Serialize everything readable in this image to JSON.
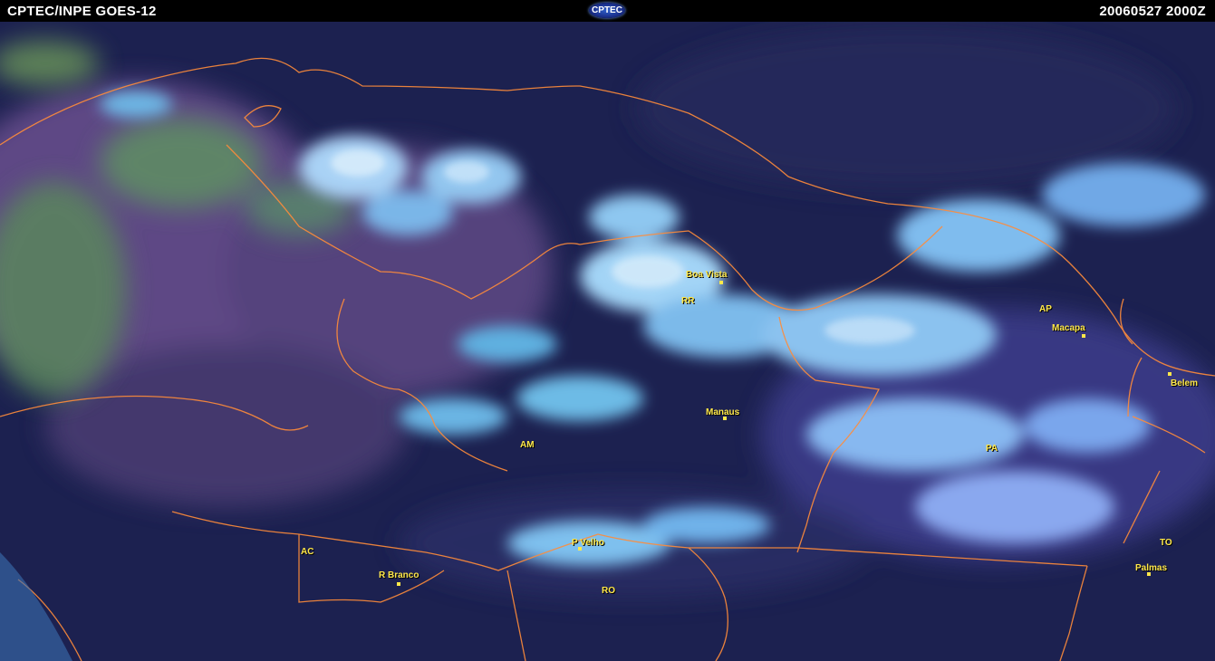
{
  "header": {
    "left_title": "CPTEC/INPE GOES-12",
    "logo_text": "CPTEC",
    "timestamp": "20060527  2000Z"
  },
  "map": {
    "cities": [
      {
        "id": "boa-vista",
        "name": "Boa Vista"
      },
      {
        "id": "macapa",
        "name": "Macapa"
      },
      {
        "id": "belem",
        "name": "Belem"
      },
      {
        "id": "manaus",
        "name": "Manaus"
      },
      {
        "id": "p-velho",
        "name": "P Velho"
      },
      {
        "id": "r-branco",
        "name": "R Branco"
      },
      {
        "id": "palmas",
        "name": "Palmas"
      }
    ],
    "states": [
      "RR",
      "AP",
      "AM",
      "PA",
      "AC",
      "RO",
      "TO"
    ],
    "colors": {
      "background": "#1a1f4a",
      "clouds": "#7fc8ff",
      "borders": "#ff8c3a",
      "labels": "#ffe84a"
    }
  }
}
